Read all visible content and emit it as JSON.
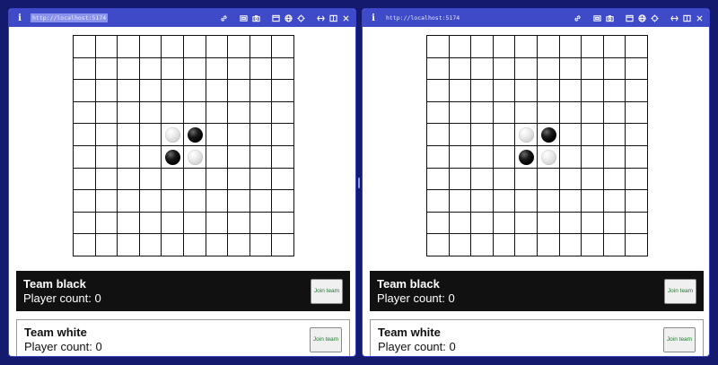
{
  "windows": [
    {
      "url": "http://localhost:5174",
      "url_selected": true,
      "teams": [
        {
          "name": "Team black",
          "count_text": "Player count: 0",
          "join_label": "Join team"
        },
        {
          "name": "Team white",
          "count_text": "Player count: 0",
          "join_label": "Join team"
        }
      ]
    },
    {
      "url": "http://localhost:5174",
      "url_selected": false,
      "teams": [
        {
          "name": "Team black",
          "count_text": "Player count: 0",
          "join_label": "Join team"
        },
        {
          "name": "Team white",
          "count_text": "Player count: 0",
          "join_label": "Join team"
        }
      ]
    }
  ],
  "board": {
    "rows": 10,
    "cols": 10,
    "stones": [
      {
        "row": 4,
        "col": 4,
        "color": "white"
      },
      {
        "row": 4,
        "col": 5,
        "color": "black"
      },
      {
        "row": 5,
        "col": 4,
        "color": "black"
      },
      {
        "row": 5,
        "col": 5,
        "color": "white"
      }
    ]
  },
  "toolbar_icons": [
    "link-icon",
    "screenshot-icon",
    "camera-icon",
    "window-icon",
    "globe-icon",
    "target-icon",
    "resize-icon",
    "split-icon",
    "close-icon"
  ],
  "colors": {
    "titlebar": "#3f4ac8",
    "background": "#141a6e",
    "join_text": "#1e7a2e"
  }
}
